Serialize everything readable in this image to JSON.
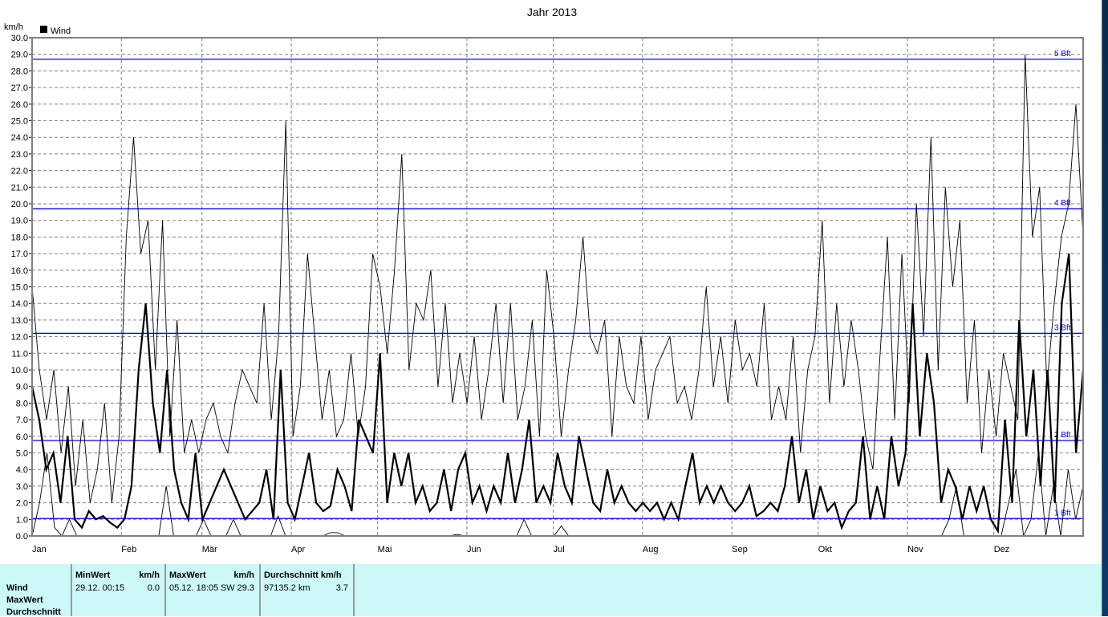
{
  "chart_data": {
    "type": "line",
    "title": "Jahr 2013",
    "ylabel": "km/h",
    "ylim": [
      0,
      30
    ],
    "yticks": [
      "0.0",
      "1.0",
      "2.0",
      "3.0",
      "4.0",
      "5.0",
      "6.0",
      "7.0",
      "8.0",
      "9.0",
      "10.0",
      "11.0",
      "12.0",
      "13.0",
      "14.0",
      "15.0",
      "16.0",
      "17.0",
      "18.0",
      "19.0",
      "20.0",
      "21.0",
      "22.0",
      "23.0",
      "24.0",
      "25.0",
      "26.0",
      "27.0",
      "28.0",
      "29.0",
      "30.0"
    ],
    "xticks": [
      "Jan",
      "Feb",
      "Mär",
      "Apr",
      "Mai",
      "Jun",
      "Jul",
      "Aug",
      "Sep",
      "Okt",
      "Nov",
      "Dez"
    ],
    "x_range": [
      "01.01.2013",
      "31.12.2013"
    ],
    "grid": true,
    "legend": {
      "label": "Wind",
      "placement": "top-left"
    },
    "beaufort_lines": [
      {
        "label": "1 Bft",
        "value": 1.05
      },
      {
        "label": "2 Bft",
        "value": 5.75
      },
      {
        "label": "3 Bft",
        "value": 12.2
      },
      {
        "label": "4 Bft",
        "value": 19.7
      },
      {
        "label": "5 Bft",
        "value": 28.7
      }
    ],
    "colors": {
      "series": "#000000",
      "beaufort": "#0000ff",
      "grid": "#808080"
    },
    "series": [
      {
        "role": "max",
        "values": [
          15,
          10,
          7,
          10,
          5,
          9,
          3,
          7,
          2,
          4,
          8,
          2,
          6,
          18,
          24,
          17,
          19,
          10,
          19,
          6,
          13,
          5,
          7,
          5,
          7,
          8,
          6,
          5,
          8,
          10,
          9,
          8,
          14,
          7,
          12,
          25,
          6,
          9,
          17,
          12,
          7,
          10,
          6,
          7,
          11,
          6,
          9,
          17,
          15,
          11,
          16,
          23,
          10,
          14,
          13,
          16,
          9,
          14,
          8,
          11,
          8,
          12,
          7,
          10,
          14,
          8,
          14,
          7,
          9,
          13,
          6,
          16,
          12,
          6,
          10,
          13,
          18,
          12,
          11,
          13,
          6,
          12,
          9,
          8,
          12,
          7,
          10,
          11,
          12,
          8,
          9,
          7,
          10,
          15,
          9,
          12,
          8,
          13,
          10,
          11,
          9,
          14,
          7,
          9,
          7,
          12,
          5,
          10,
          12,
          19,
          8,
          14,
          9,
          13,
          10,
          6,
          4,
          11,
          18,
          7,
          17,
          8,
          20,
          12,
          24,
          10,
          21,
          15,
          19,
          8,
          13,
          5,
          10,
          6,
          11,
          9,
          7,
          29,
          18,
          21,
          9,
          14,
          18,
          20,
          26,
          18
        ]
      },
      {
        "role": "average",
        "values": [
          9,
          7,
          4,
          5,
          2,
          6,
          1,
          0.5,
          1.5,
          1,
          1.2,
          0.8,
          0.5,
          1,
          3,
          10,
          14,
          8,
          5,
          10,
          4,
          2,
          1,
          5,
          1,
          2,
          3,
          4,
          3,
          2,
          1,
          1.5,
          2,
          4,
          1,
          10,
          2,
          1,
          3,
          5,
          2,
          1.5,
          1.8,
          4,
          3,
          1.5,
          7,
          6,
          5,
          11,
          2,
          5,
          3,
          5,
          2,
          3,
          1.5,
          2,
          4,
          1.5,
          4,
          5,
          2,
          3,
          1.5,
          3,
          2,
          5,
          2,
          4,
          7,
          2,
          3,
          2,
          5,
          3,
          2,
          6,
          4,
          2,
          1.5,
          4,
          2,
          3,
          2,
          1.5,
          2,
          1.5,
          2,
          1,
          2,
          1,
          3,
          5,
          2,
          3,
          2,
          3,
          2,
          1.5,
          2,
          3,
          1.2,
          1.5,
          2,
          1.5,
          3,
          6,
          2,
          4,
          1,
          3,
          1.5,
          2,
          0.5,
          1.5,
          2,
          6,
          1,
          3,
          1,
          6,
          3,
          5,
          14,
          6,
          11,
          8,
          2,
          4,
          3,
          1,
          3,
          1.5,
          3,
          1,
          0.3,
          7,
          2,
          13,
          6,
          10,
          3,
          10,
          2,
          14,
          17,
          5,
          10
        ]
      },
      {
        "role": "min",
        "values": [
          0,
          2,
          5,
          0.5,
          0,
          1,
          0,
          0,
          0,
          0,
          0,
          0,
          0,
          0,
          0,
          0,
          0,
          0,
          3,
          0,
          0,
          0,
          0,
          1,
          0,
          0,
          0,
          1,
          0,
          0,
          0,
          0,
          0,
          1.2,
          0,
          0,
          0,
          0,
          0,
          0,
          0.2,
          0.2,
          0,
          0,
          0,
          0,
          0,
          0,
          0,
          0,
          0,
          0,
          0,
          0,
          0,
          0,
          0,
          0.1,
          0,
          0,
          0,
          0,
          0,
          0,
          0,
          0,
          1,
          0,
          0,
          0,
          0,
          0.6,
          0,
          0,
          0,
          0,
          0,
          0,
          0,
          0,
          0,
          0,
          0,
          0,
          0,
          0,
          0,
          0,
          0,
          0,
          0,
          0,
          0,
          0,
          0,
          0,
          0,
          0,
          0,
          0,
          0,
          0,
          0,
          0,
          0,
          0,
          0,
          0,
          0,
          0,
          0,
          0,
          0,
          0,
          0,
          0,
          0,
          0,
          0,
          0,
          0,
          0,
          0,
          1,
          3,
          0,
          0,
          0,
          0,
          0,
          0,
          2,
          4,
          0,
          1,
          5,
          0,
          3,
          0,
          4,
          1,
          3
        ]
      }
    ]
  },
  "table": {
    "row_labels": [
      "Wind",
      "MaxWert",
      "Durchschnitt"
    ],
    "min": {
      "header": "MinWert",
      "unit": "km/h",
      "date": "29.12.  00:15",
      "value": "0.0"
    },
    "max": {
      "header": "MaxWert",
      "unit": "km/h",
      "date": "05.12.  18:05",
      "dir_value": "SW 29.3"
    },
    "avg": {
      "header": "Durchschnitt km/h",
      "distance": "97135.2 km",
      "value": "3.7"
    }
  }
}
